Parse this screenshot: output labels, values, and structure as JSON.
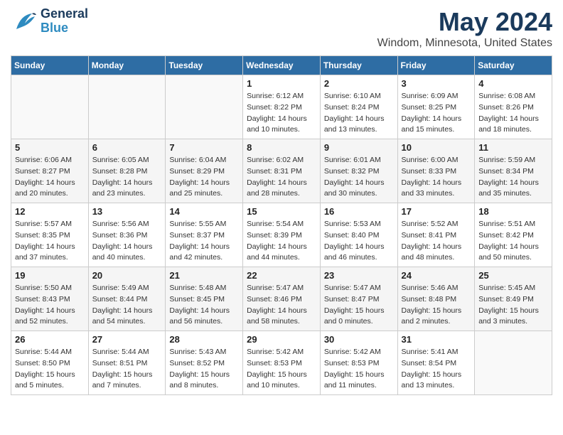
{
  "header": {
    "logo_general": "General",
    "logo_blue": "Blue",
    "title": "May 2024",
    "subtitle": "Windom, Minnesota, United States"
  },
  "calendar": {
    "days_of_week": [
      "Sunday",
      "Monday",
      "Tuesday",
      "Wednesday",
      "Thursday",
      "Friday",
      "Saturday"
    ],
    "weeks": [
      [
        {
          "date": "",
          "info": ""
        },
        {
          "date": "",
          "info": ""
        },
        {
          "date": "",
          "info": ""
        },
        {
          "date": "1",
          "info": "Sunrise: 6:12 AM\nSunset: 8:22 PM\nDaylight: 14 hours\nand 10 minutes."
        },
        {
          "date": "2",
          "info": "Sunrise: 6:10 AM\nSunset: 8:24 PM\nDaylight: 14 hours\nand 13 minutes."
        },
        {
          "date": "3",
          "info": "Sunrise: 6:09 AM\nSunset: 8:25 PM\nDaylight: 14 hours\nand 15 minutes."
        },
        {
          "date": "4",
          "info": "Sunrise: 6:08 AM\nSunset: 8:26 PM\nDaylight: 14 hours\nand 18 minutes."
        }
      ],
      [
        {
          "date": "5",
          "info": "Sunrise: 6:06 AM\nSunset: 8:27 PM\nDaylight: 14 hours\nand 20 minutes."
        },
        {
          "date": "6",
          "info": "Sunrise: 6:05 AM\nSunset: 8:28 PM\nDaylight: 14 hours\nand 23 minutes."
        },
        {
          "date": "7",
          "info": "Sunrise: 6:04 AM\nSunset: 8:29 PM\nDaylight: 14 hours\nand 25 minutes."
        },
        {
          "date": "8",
          "info": "Sunrise: 6:02 AM\nSunset: 8:31 PM\nDaylight: 14 hours\nand 28 minutes."
        },
        {
          "date": "9",
          "info": "Sunrise: 6:01 AM\nSunset: 8:32 PM\nDaylight: 14 hours\nand 30 minutes."
        },
        {
          "date": "10",
          "info": "Sunrise: 6:00 AM\nSunset: 8:33 PM\nDaylight: 14 hours\nand 33 minutes."
        },
        {
          "date": "11",
          "info": "Sunrise: 5:59 AM\nSunset: 8:34 PM\nDaylight: 14 hours\nand 35 minutes."
        }
      ],
      [
        {
          "date": "12",
          "info": "Sunrise: 5:57 AM\nSunset: 8:35 PM\nDaylight: 14 hours\nand 37 minutes."
        },
        {
          "date": "13",
          "info": "Sunrise: 5:56 AM\nSunset: 8:36 PM\nDaylight: 14 hours\nand 40 minutes."
        },
        {
          "date": "14",
          "info": "Sunrise: 5:55 AM\nSunset: 8:37 PM\nDaylight: 14 hours\nand 42 minutes."
        },
        {
          "date": "15",
          "info": "Sunrise: 5:54 AM\nSunset: 8:39 PM\nDaylight: 14 hours\nand 44 minutes."
        },
        {
          "date": "16",
          "info": "Sunrise: 5:53 AM\nSunset: 8:40 PM\nDaylight: 14 hours\nand 46 minutes."
        },
        {
          "date": "17",
          "info": "Sunrise: 5:52 AM\nSunset: 8:41 PM\nDaylight: 14 hours\nand 48 minutes."
        },
        {
          "date": "18",
          "info": "Sunrise: 5:51 AM\nSunset: 8:42 PM\nDaylight: 14 hours\nand 50 minutes."
        }
      ],
      [
        {
          "date": "19",
          "info": "Sunrise: 5:50 AM\nSunset: 8:43 PM\nDaylight: 14 hours\nand 52 minutes."
        },
        {
          "date": "20",
          "info": "Sunrise: 5:49 AM\nSunset: 8:44 PM\nDaylight: 14 hours\nand 54 minutes."
        },
        {
          "date": "21",
          "info": "Sunrise: 5:48 AM\nSunset: 8:45 PM\nDaylight: 14 hours\nand 56 minutes."
        },
        {
          "date": "22",
          "info": "Sunrise: 5:47 AM\nSunset: 8:46 PM\nDaylight: 14 hours\nand 58 minutes."
        },
        {
          "date": "23",
          "info": "Sunrise: 5:47 AM\nSunset: 8:47 PM\nDaylight: 15 hours\nand 0 minutes."
        },
        {
          "date": "24",
          "info": "Sunrise: 5:46 AM\nSunset: 8:48 PM\nDaylight: 15 hours\nand 2 minutes."
        },
        {
          "date": "25",
          "info": "Sunrise: 5:45 AM\nSunset: 8:49 PM\nDaylight: 15 hours\nand 3 minutes."
        }
      ],
      [
        {
          "date": "26",
          "info": "Sunrise: 5:44 AM\nSunset: 8:50 PM\nDaylight: 15 hours\nand 5 minutes."
        },
        {
          "date": "27",
          "info": "Sunrise: 5:44 AM\nSunset: 8:51 PM\nDaylight: 15 hours\nand 7 minutes."
        },
        {
          "date": "28",
          "info": "Sunrise: 5:43 AM\nSunset: 8:52 PM\nDaylight: 15 hours\nand 8 minutes."
        },
        {
          "date": "29",
          "info": "Sunrise: 5:42 AM\nSunset: 8:53 PM\nDaylight: 15 hours\nand 10 minutes."
        },
        {
          "date": "30",
          "info": "Sunrise: 5:42 AM\nSunset: 8:53 PM\nDaylight: 15 hours\nand 11 minutes."
        },
        {
          "date": "31",
          "info": "Sunrise: 5:41 AM\nSunset: 8:54 PM\nDaylight: 15 hours\nand 13 minutes."
        },
        {
          "date": "",
          "info": ""
        }
      ]
    ]
  }
}
